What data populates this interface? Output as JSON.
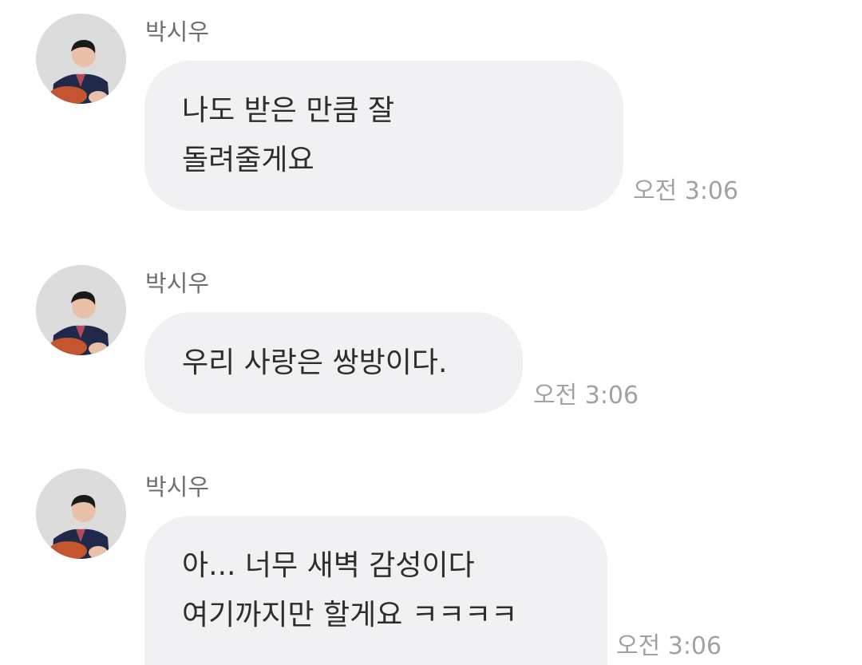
{
  "messages": [
    {
      "sender": "박시우",
      "lines": [
        "나도 받은 만큼 잘",
        "돌려줄게요"
      ],
      "time": "오전 3:06"
    },
    {
      "sender": "박시우",
      "lines": [
        "우리 사랑은 쌍방이다."
      ],
      "time": "오전 3:06"
    },
    {
      "sender": "박시우",
      "lines": [
        "아... 너무 새벽 감성이다",
        "여기까지만 할게요 ㅋㅋㅋㅋ"
      ],
      "time": "오전 3:06"
    }
  ],
  "colors": {
    "bubble": "#f1f1f3",
    "message_text": "#2d2d2d",
    "sender_text": "#6e6e6e",
    "time_text": "#a2a2a2"
  },
  "icons": {
    "avatar": "profile-photo"
  }
}
